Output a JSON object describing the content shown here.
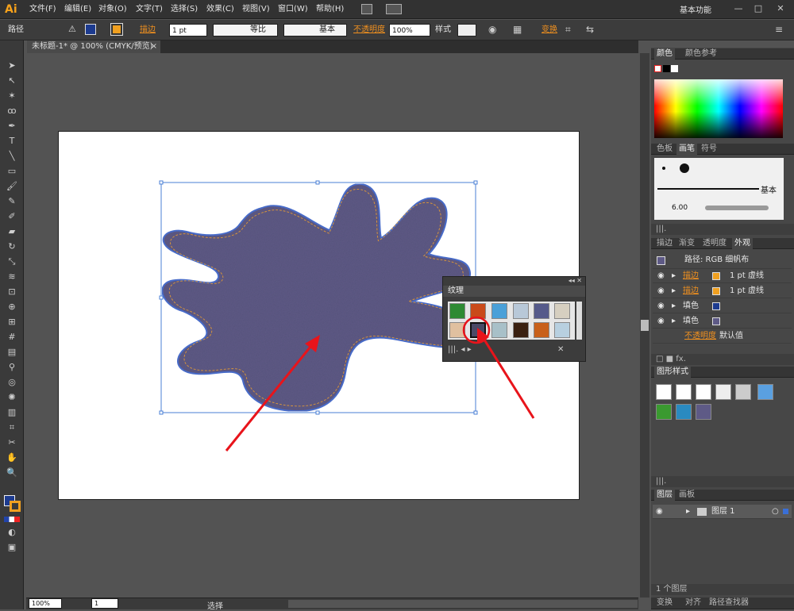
{
  "app": {
    "logo": "Ai",
    "workspace": "基本功能"
  },
  "menu": [
    "文件(F)",
    "编辑(E)",
    "对象(O)",
    "文字(T)",
    "选择(S)",
    "效果(C)",
    "视图(V)",
    "窗口(W)",
    "帮助(H)"
  ],
  "control": {
    "object_type": "路径",
    "stroke_label": "描边",
    "stroke_weight": "1 pt",
    "profile": "等比",
    "brush": "基本",
    "opacity_label": "不透明度",
    "opacity_value": "100%",
    "style_label": "样式",
    "transform_label": "变换"
  },
  "document_tab": {
    "title": "未标题-1* @ 100% (CMYK/预览)",
    "close": "×"
  },
  "status": {
    "zoom": "100%",
    "artboard": "1",
    "tool": "选择"
  },
  "panels": {
    "color_tabs": [
      "颜色",
      "颜色参考"
    ],
    "brush_tabs": [
      "色板",
      "画笔",
      "符号"
    ],
    "brush_basic": "基本",
    "brush_size": "6.00",
    "appearance_tabs": [
      "描边",
      "渐变",
      "透明度",
      "外观"
    ],
    "appearance": {
      "title": "路径: RGB 细帆布",
      "rows": [
        {
          "label": "描边",
          "value": "1 pt 虚线"
        },
        {
          "label": "描边",
          "value": "1 pt 虚线"
        },
        {
          "label": "填色",
          "value": ""
        },
        {
          "label": "填色",
          "value": ""
        }
      ],
      "opacity_label": "不透明度",
      "opacity_value": "默认值"
    },
    "graphic_styles_tab": "图形样式",
    "layers_tabs": [
      "图层",
      "画板"
    ],
    "layer_name": "图层 1",
    "layer_count": "1 个图层",
    "bottom_tabs": [
      "变换",
      "对齐",
      "路径查找器"
    ]
  },
  "texture_panel": {
    "title": "纹理"
  },
  "colors": {
    "accent_orange": "#f0901f",
    "selection_blue": "#4a7fd6",
    "shape_fill": "#5e5a86",
    "stitch": "#d9953a",
    "arrow": "#e8141b"
  }
}
